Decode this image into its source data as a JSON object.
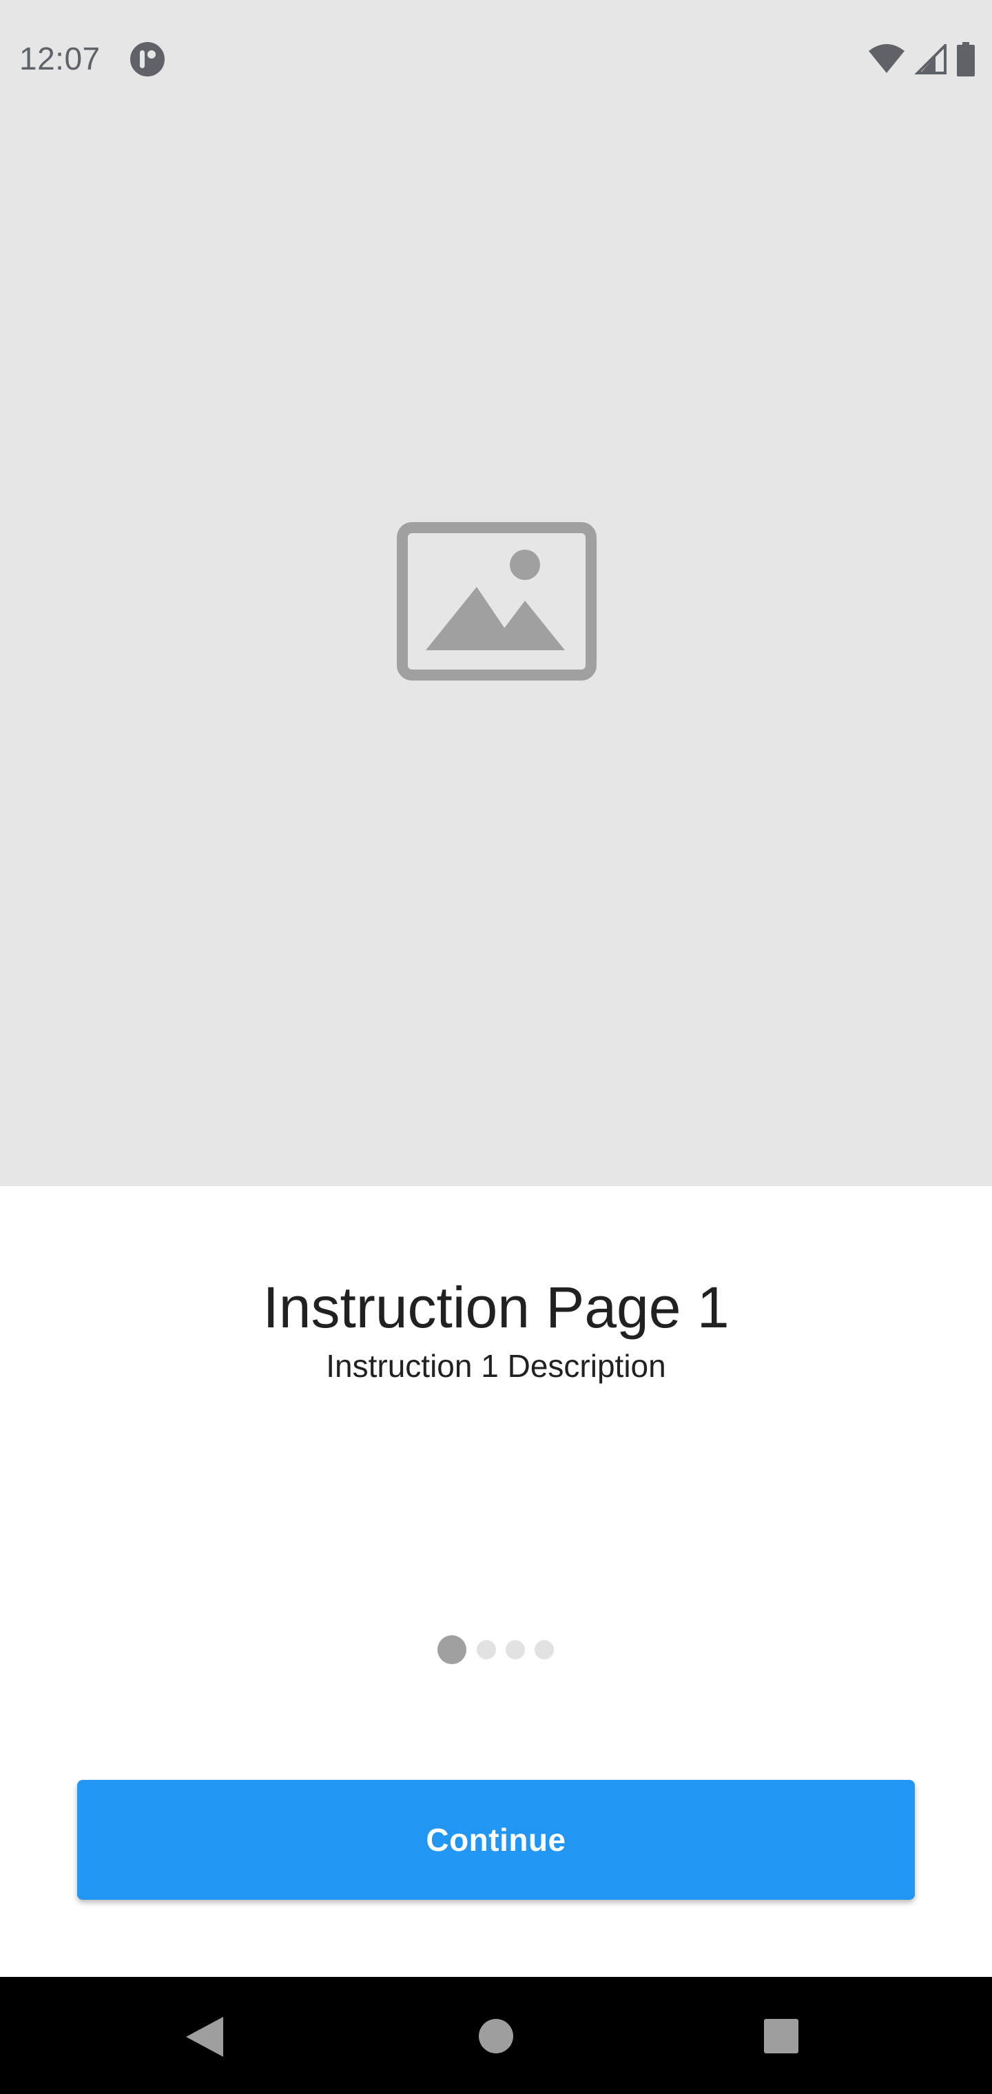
{
  "status_bar": {
    "time": "12:07",
    "icons": [
      "app-notification-icon",
      "wifi-icon",
      "cellular-signal-icon",
      "battery-icon"
    ]
  },
  "hero": {
    "placeholder_icon": "image-placeholder-icon",
    "background_color": "#e6e6e6"
  },
  "content": {
    "title": "Instruction Page 1",
    "description": "Instruction 1 Description"
  },
  "pager": {
    "total_pages": 4,
    "current_page": 1
  },
  "actions": {
    "continue_label": "Continue",
    "accent_color": "#2196f3"
  },
  "nav_bar": {
    "icons": [
      "back-icon",
      "home-icon",
      "recents-icon"
    ]
  }
}
